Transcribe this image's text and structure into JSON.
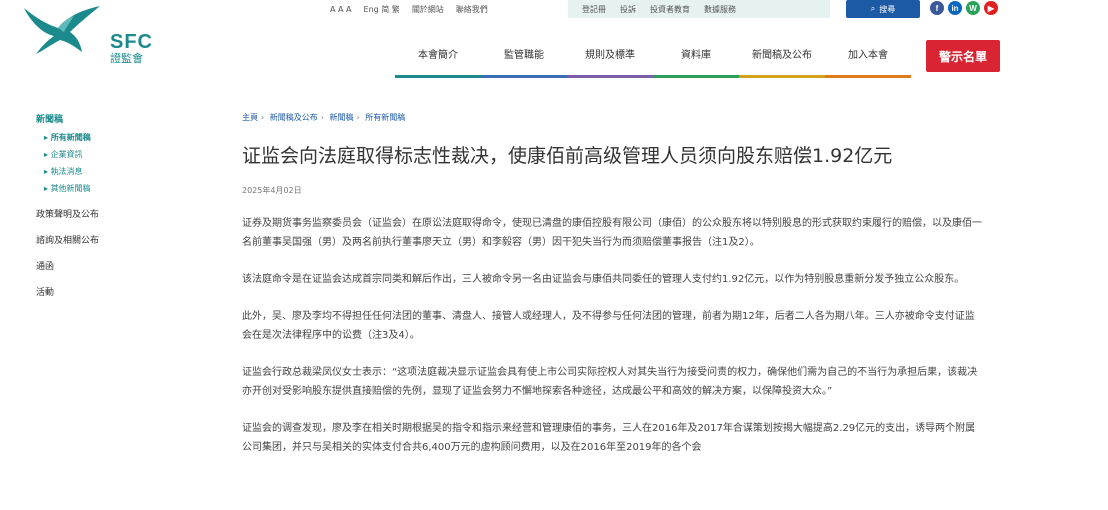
{
  "logo": {
    "abbr": "SFC",
    "cn": "證監會"
  },
  "util": {
    "font_sizes": "A A A",
    "languages": "Eng 简 繁",
    "about": "關於網站",
    "contact": "聯絡我們"
  },
  "util_links": [
    "登記冊",
    "投訴",
    "投資者教育",
    "數據服務"
  ],
  "search_label": "搜尋",
  "social": [
    {
      "label": "f",
      "color": "#3b5998"
    },
    {
      "label": "in",
      "color": "#0a66c2"
    },
    {
      "label": "W",
      "color": "#2aa35a"
    },
    {
      "label": "▶",
      "color": "#e02020"
    }
  ],
  "nav": [
    {
      "label": "本會簡介",
      "color": "#1a8a8c"
    },
    {
      "label": "監管職能",
      "color": "#3a6db3"
    },
    {
      "label": "規則及標準",
      "color": "#7b5ea7"
    },
    {
      "label": "資料庫",
      "color": "#2c9e5c"
    },
    {
      "label": "新聞稿及公布",
      "color": "#d4a21a"
    },
    {
      "label": "加入本會",
      "color": "#e07b1a"
    }
  ],
  "warn_button": "警示名單",
  "sidebar": {
    "title": "新聞稿",
    "subs": [
      "所有新聞稿",
      "企業資訊",
      "執法消息",
      "其他新聞稿"
    ],
    "mains": [
      "政策聲明及公布",
      "諮詢及相關公布",
      "通函",
      "活動"
    ]
  },
  "breadcrumb": [
    "主頁",
    "新聞稿及公布",
    "新聞稿",
    "所有新聞稿"
  ],
  "article": {
    "title": "证监会向法庭取得标志性裁决，使康佰前高级管理人员须向股东赔偿1.92亿元",
    "date": "2025年4月02日",
    "paragraphs": [
      "证券及期货事务监察委员会（证监会）在原讼法庭取得命令，使现已清盘的康佰控股有限公司（康佰）的公众股东将以特别股息的形式获取约束履行的赔偿，以及康佰一名前董事吴国强（男）及两名前执行董事廖天立（男）和李毅容（男）因干犯失当行为而须赔偿董事报告（注1及2）。",
      "该法庭命令是在证监会达成首宗同类和解后作出，三人被命令另一名由证监会与康佰共同委任的管理人支付约1.92亿元，以作为特别股息重新分发予独立公众股东。",
      "此外，吴、廖及李均不得担任任何法团的董事、清盘人、接管人或经理人，及不得参与任何法团的管理，前者为期12年，后者二人各为期八年。三人亦被命令支付证监会在是次法律程序中的讼费（注3及4）。",
      "证监会行政总裁梁凤仪女士表示：“这项法庭裁决显示证监会具有使上市公司实际控权人对其失当行为接受问责的权力，确保他们需为自己的不当行为承担后果，该裁决亦开创对受影响股东提供直接赔偿的先例，显现了证监会努力不懈地探索各种途径，达成最公平和高效的解决方案，以保障投资大众。”",
      "证监会的调查发现，廖及李在相关时期根据吴的指令和指示来经营和管理康佰的事务，三人在2016年及2017年合谋策划按揭大幅提高2.29亿元的支出，诱导两个附属公司集团，并只与吴相关的实体支付合共6,400万元的虚构顾问费用，以及在2016年至2019年的各个会"
    ]
  }
}
